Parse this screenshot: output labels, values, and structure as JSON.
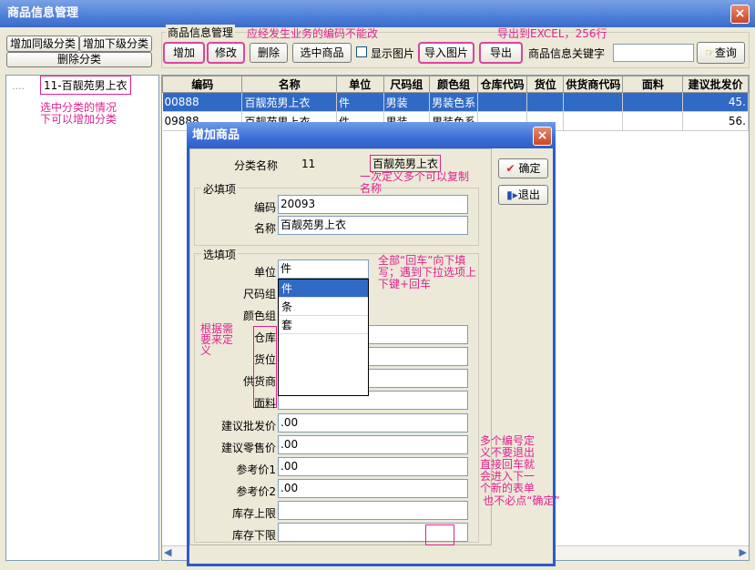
{
  "window": {
    "title": "商品信息管理",
    "close": "×"
  },
  "left_buttons": {
    "add_same": "增加同级分类",
    "add_sub": "增加下级分类",
    "delete": "删除分类"
  },
  "group_title": "商品信息管理",
  "toolbar": {
    "add": "增加",
    "edit": "修改",
    "delete": "删除",
    "select": "选中商品",
    "show_images_label": "显示图片",
    "import_images": "导入图片",
    "export": "导出",
    "keyword_label": "商品信息关键字",
    "search": "查询"
  },
  "tree": {
    "item": "11-百靓苑男上衣"
  },
  "grid": {
    "headers": [
      "编码",
      "名称",
      "单位",
      "尺码组",
      "颜色组",
      "仓库代码",
      "货位",
      "供货商代码",
      "面料",
      "建议批发价"
    ],
    "rows": [
      [
        "00888",
        "百靓苑男上衣",
        "件",
        "男装",
        "男装色系",
        "",
        "",
        "",
        "",
        "45."
      ],
      [
        "09888",
        "百靓苑男上衣",
        "件",
        "男装",
        "男装色系",
        "",
        "",
        "",
        "",
        "56."
      ]
    ]
  },
  "annotations": {
    "a1": "应经发生业务的编码不能改",
    "a2": "导出到EXCEL，256行",
    "a3": "选中分类的情况下可以增加分类",
    "a4": "一次定义多个可以复制名称",
    "a5": "全部“回车”向下填写；遇到下拉选项上下键+回车",
    "a6": "根据需要来定义",
    "a7": "多个编号定义不要退出直接回车就会进入下一个新的表单",
    "a8": "也不必点“确定”"
  },
  "dialog": {
    "title": "增加商品",
    "close": "×",
    "ok": "确定",
    "exit": "退出",
    "category_label": "分类名称",
    "category_code": "11",
    "category_name": "百靓苑男上衣",
    "required_group": "必填项",
    "optional_group": "选填项",
    "code_label": "编码",
    "code_value": "20093",
    "name_label": "名称",
    "name_value": "百靓苑男上衣",
    "unit_label": "单位",
    "unit_value": "件",
    "size_label": "尺码组",
    "color_label": "颜色组",
    "warehouse_label": "仓库",
    "location_label": "货位",
    "supplier_label": "供货商",
    "fabric_label": "面料",
    "wholesale_label": "建议批发价",
    "wholesale_value": ".00",
    "retail_label": "建议零售价",
    "retail_value": ".00",
    "ref1_label": "参考价1",
    "ref1_value": ".00",
    "ref2_label": "参考价2",
    "ref2_value": ".00",
    "stock_max_label": "库存上限",
    "stock_min_label": "库存下限",
    "unit_options": [
      "件",
      "条",
      "套"
    ]
  }
}
